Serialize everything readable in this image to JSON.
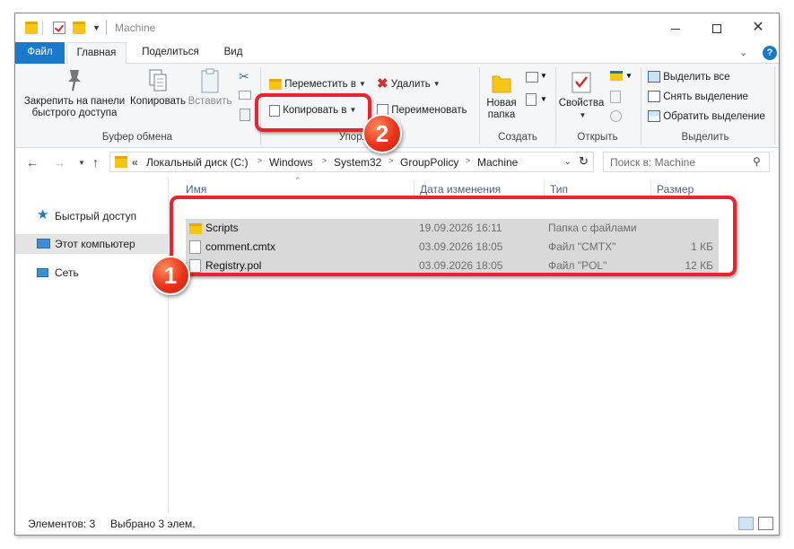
{
  "window": {
    "title": "Machine"
  },
  "tabs": {
    "file": "Файл",
    "home": "Главная",
    "share": "Поделиться",
    "view": "Вид"
  },
  "ribbon": {
    "clipboard": {
      "pin_label_1": "Закрепить на панели",
      "pin_label_2": "быстрого доступа",
      "copy_label": "Копировать",
      "paste_label": "Вставить",
      "group_label": "Буфер обмена"
    },
    "organize": {
      "move_to": "Переместить в",
      "copy_to": "Копировать в",
      "delete": "Удалить",
      "rename": "Переименовать",
      "group_label": "Упорядочить"
    },
    "new": {
      "new_folder_1": "Новая",
      "new_folder_2": "папка",
      "group_label": "Создать"
    },
    "open": {
      "properties": "Свойства",
      "group_label": "Открыть"
    },
    "select": {
      "select_all": "Выделить все",
      "select_none": "Снять выделение",
      "invert": "Обратить выделение",
      "group_label": "Выделить"
    }
  },
  "address": {
    "overflow": "«",
    "crumbs": [
      "Локальный диск (C:)",
      "Windows",
      "System32",
      "GroupPolicy",
      "Machine"
    ],
    "search_placeholder": "Поиск в: Machine"
  },
  "nav": {
    "items": [
      {
        "label": "Быстрый доступ",
        "icon": "star-icon"
      },
      {
        "label": "Этот компьютер",
        "icon": "computer-icon"
      },
      {
        "label": "Сеть",
        "icon": "network-icon"
      }
    ]
  },
  "filelist": {
    "columns": {
      "name": "Имя",
      "date": "Дата изменения",
      "type": "Тип",
      "size": "Размер"
    },
    "rows": [
      {
        "name": "Scripts",
        "date": "19.09.2026 16:11",
        "type": "Папка с файлами",
        "size": "",
        "icon": "folder-icon"
      },
      {
        "name": "comment.cmtx",
        "date": "03.09.2026 18:05",
        "type": "Файл \"CMTX\"",
        "size": "1 КБ",
        "icon": "file-icon"
      },
      {
        "name": "Registry.pol",
        "date": "03.09.2026 18:05",
        "type": "Файл \"POL\"",
        "size": "12 КБ",
        "icon": "file-icon"
      }
    ]
  },
  "status": {
    "items_count": "Элементов: 3",
    "selected_count": "Выбрано 3 элем."
  },
  "annotations": {
    "badge_1": "1",
    "badge_2": "2"
  },
  "colors": {
    "accent": "#1979ca",
    "selection": "#d9d9d9",
    "callout": "#e8242f"
  }
}
